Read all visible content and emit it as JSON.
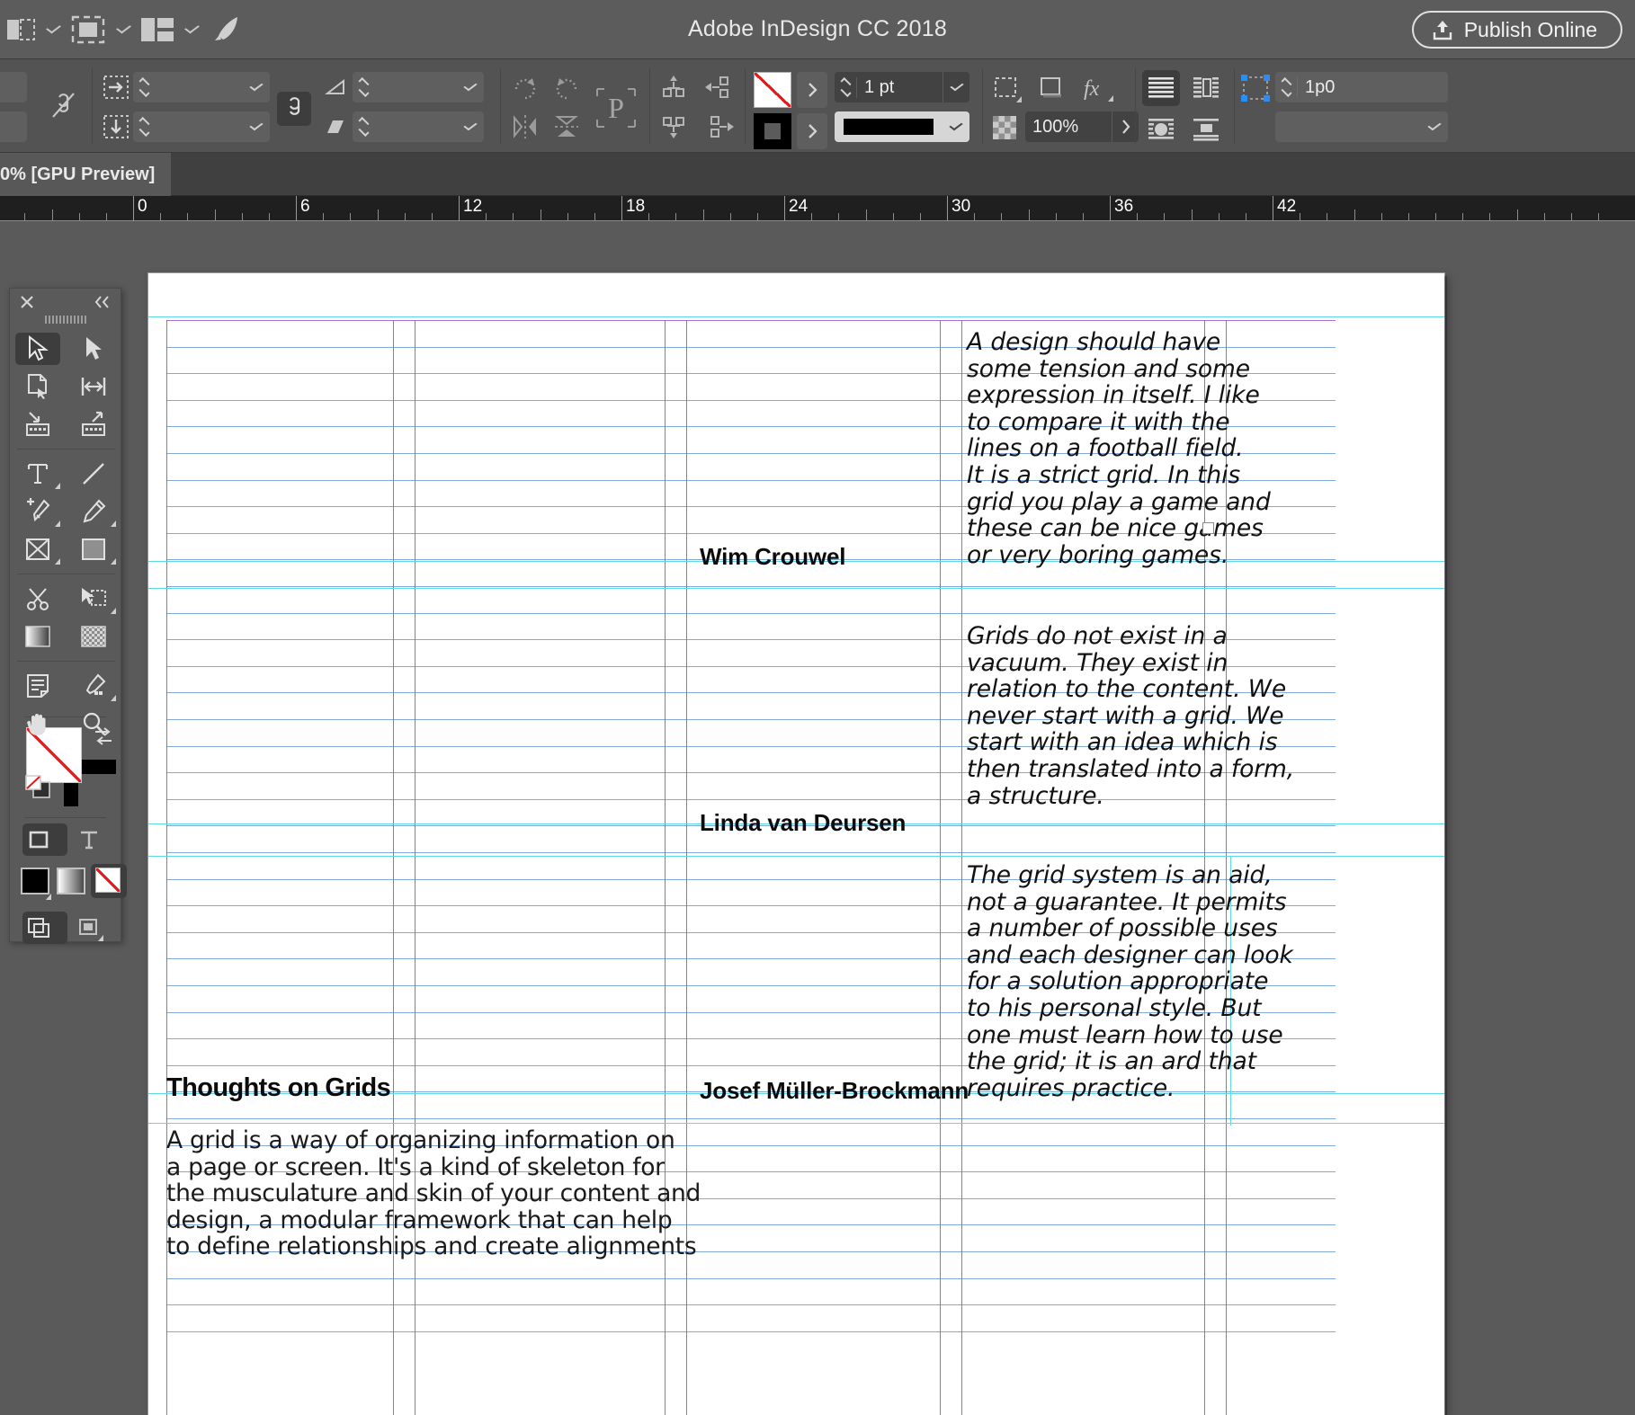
{
  "window": {
    "title": "Adobe InDesign CC 2018",
    "publish_label": "Publish Online",
    "publish_icon": "upload-icon"
  },
  "titlebar_icons": [
    {
      "name": "screen-mode-icon",
      "caret": true
    },
    {
      "name": "view-options-icon",
      "caret": true
    },
    {
      "name": "arrange-documents-icon",
      "caret": true
    },
    {
      "name": "cc-libraries-rocket-icon",
      "caret": false
    }
  ],
  "control_bar": {
    "link_icon": "break-link-icon",
    "indent_left_icon": "indent-right-arrow-icon",
    "indent_down_icon": "indent-down-arrow-icon",
    "chain_icon": "chain-link-icon",
    "shear_icon": "shear-triangle-icon",
    "skew_icon": "skew-parallelogram-icon",
    "rotate_cw_icon": "rotate-clockwise-icon",
    "rotate_ccw_icon": "rotate-counterclockwise-icon",
    "flip_h_icon": "flip-horizontal-icon",
    "flip_v_icon": "flip-vertical-icon",
    "paragraph_icon": "paragraph-mark-icon",
    "align_top_icon": "distribute-top-icon",
    "align_left_icon": "distribute-left-icon",
    "align_bottom_icon": "distribute-bottom-icon",
    "align_right_icon": "distribute-right-icon",
    "fill_swatch": "none-fill-swatch",
    "stroke_swatch": "black-stroke-swatch",
    "stroke_weight": "1 pt",
    "stroke_style_icon": "solid-line-style",
    "corner_options_icon": "corner-options-icon",
    "drop_shadow_icon": "drop-shadow-icon",
    "effects_icon": "fx-effects-icon",
    "opacity_icon": "transparency-grid-icon",
    "opacity_value": "100%",
    "wrap_none_icon": "text-wrap-none-icon",
    "wrap_object_icon": "text-wrap-bounding-box-icon",
    "wrap_shape_icon": "text-wrap-object-shape-icon",
    "wrap_jump_icon": "text-wrap-jump-object-icon",
    "num_columns_icon": "selection-reference-point-icon",
    "gutter_value": "1p0",
    "colors": {
      "panel_bg": "#535353",
      "field_bg": "#5f5f5f",
      "accent_blue": "#2d8cf0",
      "none_red": "#e01b1b"
    }
  },
  "document_tab": {
    "label": "0% [GPU Preview]"
  },
  "ruler": {
    "units": "picas",
    "ticks": [
      "0",
      "6",
      "12",
      "18",
      "24",
      "30",
      "36",
      "42"
    ]
  },
  "tools": {
    "close_icon": "close-x-icon",
    "collapse_icon": "collapse-double-chevron-icon",
    "items": [
      {
        "name": "selection-tool",
        "active": true
      },
      {
        "name": "direct-selection-tool",
        "active": false
      },
      {
        "name": "page-tool",
        "active": false
      },
      {
        "name": "gap-tool",
        "active": false
      },
      {
        "name": "content-collector-tool",
        "active": false
      },
      {
        "name": "content-placer-tool",
        "active": false
      },
      {
        "name": "type-tool",
        "active": false
      },
      {
        "name": "line-tool",
        "active": false
      },
      {
        "name": "pen-tool",
        "active": false
      },
      {
        "name": "pencil-tool",
        "active": false
      },
      {
        "name": "frame-tool",
        "active": false
      },
      {
        "name": "rectangle-tool",
        "active": false
      },
      {
        "name": "scissors-tool",
        "active": false
      },
      {
        "name": "free-transform-tool",
        "active": false
      },
      {
        "name": "gradient-swatch-tool",
        "active": false
      },
      {
        "name": "gradient-feather-tool",
        "active": false
      },
      {
        "name": "note-tool",
        "active": false
      },
      {
        "name": "eyedropper-tool",
        "active": false
      },
      {
        "name": "hand-tool",
        "active": false
      },
      {
        "name": "zoom-tool",
        "active": false
      }
    ],
    "format_container_icon": "format-affects-container-icon",
    "format_text_icon": "format-affects-text-icon",
    "apply_color_icon": "apply-color-icon",
    "apply_gradient_icon": "apply-gradient-icon",
    "apply_none_icon": "apply-none-icon",
    "normal_view_icon": "normal-view-mode-icon",
    "preview_view_icon": "preview-view-mode-icon"
  },
  "document": {
    "quotes": [
      {
        "text": "A design should have some tension and some expression in itself. I like to compare it with the lines on a football field. It is a strict grid. In this grid you play a game and these can be nice games or very boring games.",
        "lines": [
          "A design should have",
          "some tension and some",
          "expression in itself. I like",
          "to compare it with the",
          "lines on a football field.",
          "It is a strict grid. In this",
          "grid you play a game and",
          "these can be nice games",
          "or very boring games."
        ],
        "author": "Wim Crouwel"
      },
      {
        "text": "Grids do not exist in a vacuum. They exist in relation to the content. We never start with a grid. We start with an idea which is then translated into a form, a structure.",
        "lines": [
          "Grids do not exist in a",
          "vacuum. They exist in",
          "relation to the content. We",
          "never start with a grid. We",
          "start with an idea which is",
          "then translated into a form,",
          "a structure."
        ],
        "author": "Linda van Deursen"
      },
      {
        "text": "The grid system is an aid, not a guarantee. It permits a number of possible uses and each designer can look for a solution appropriate to his personal style. But one must learn how to use the grid; it is an ard that requires practice.",
        "lines": [
          "The grid system is an aid,",
          "not a guarantee. It permits",
          "a number of possible uses",
          "and each designer can look",
          "for a solution appropriate",
          "to his personal style. But",
          "one must learn how to use",
          "the grid; it is an ard that",
          "requires practice."
        ],
        "author": "Josef Müller-Brockmann"
      }
    ],
    "headline": "Thoughts on Grids",
    "body_lines": [
      "A grid is a way of organizing information on",
      "a page or screen. It's a kind of skeleton for",
      "the musculature and skin of your content and",
      "design, a modular framework that can help",
      "to define relationships and create alignments"
    ],
    "guide_colors": {
      "baseline": "#6f9bd1",
      "column": "#9b4fd6",
      "margin": "#5fd8e8",
      "bleed": "#cf3fcf"
    }
  }
}
